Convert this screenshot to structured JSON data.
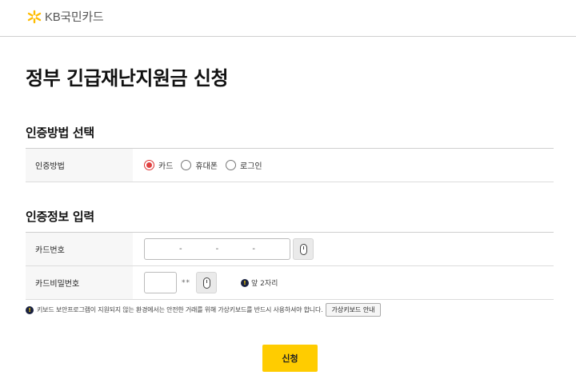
{
  "header": {
    "brand_name": "KB국민카드",
    "logo_icon": "kb-star-logo-icon",
    "brand_color": "#ffbc00"
  },
  "page_title": "정부 긴급재난지원금 신청",
  "auth_method_section": {
    "title": "인증방법 선택",
    "row_label": "인증방법",
    "options": [
      {
        "label": "카드",
        "selected": true
      },
      {
        "label": "휴대폰",
        "selected": false
      },
      {
        "label": "로그인",
        "selected": false
      }
    ]
  },
  "auth_info_section": {
    "title": "인증정보 입력",
    "card_number_label": "카드번호",
    "card_number_separators": [
      "-",
      "-",
      "-"
    ],
    "card_password_label": "카드비밀번호",
    "password_mask": "**",
    "password_hint": "앞 2자리"
  },
  "notice": {
    "text": "키보드 보안프로그램이 지원되지 않는 환경에서는 안전한 거래를 위해 가상키보드를 반드시 사용하셔야 합니다.",
    "button_label": "가상키보드 안내"
  },
  "submit_label": "신청",
  "colors": {
    "accent": "#ffcc00",
    "radio_selected": "#e04040"
  }
}
